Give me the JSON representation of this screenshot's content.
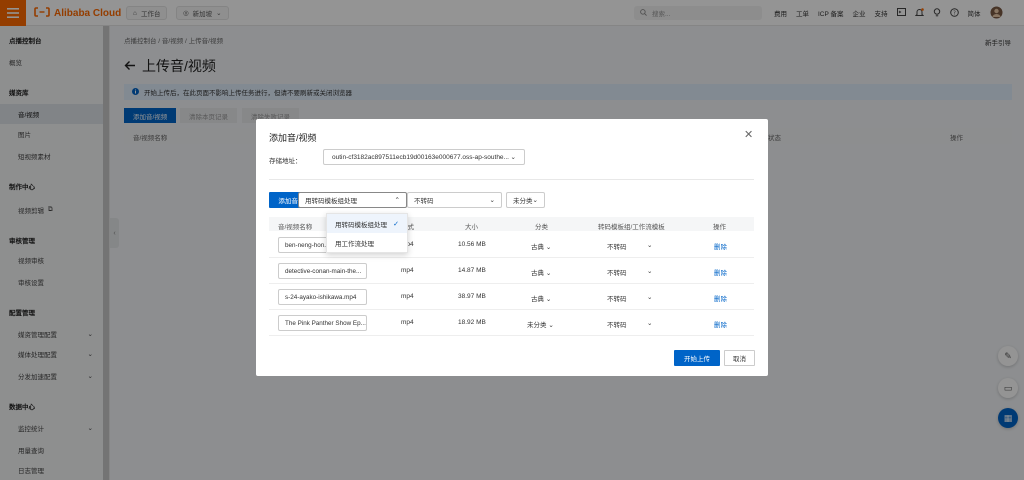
{
  "topbar": {
    "brand": "Alibaba Cloud",
    "workbench": "工作台",
    "region": "新加坡",
    "search_placeholder": "搜索...",
    "nav": [
      "费用",
      "工单",
      "ICP 备案",
      "企业",
      "支持"
    ],
    "lang": "简体",
    "accent": "#ff6a00"
  },
  "sidebar": {
    "title": "点播控制台",
    "items": [
      {
        "label": "概览",
        "type": "item"
      },
      {
        "label": "媒资库",
        "type": "section"
      },
      {
        "label": "音/视频",
        "type": "sub",
        "active": true
      },
      {
        "label": "图片",
        "type": "sub"
      },
      {
        "label": "短视频素材",
        "type": "sub"
      },
      {
        "label": "制作中心",
        "type": "section"
      },
      {
        "label": "视频剪辑",
        "type": "sub",
        "icon": "external-link-icon"
      },
      {
        "label": "审核管理",
        "type": "section"
      },
      {
        "label": "视频审核",
        "type": "sub"
      },
      {
        "label": "审核设置",
        "type": "sub"
      },
      {
        "label": "配置管理",
        "type": "section"
      },
      {
        "label": "媒资管理配置",
        "type": "sub",
        "chevron": true
      },
      {
        "label": "媒体处理配置",
        "type": "sub",
        "chevron": true
      },
      {
        "label": "分发加速配置",
        "type": "sub",
        "chevron": true
      },
      {
        "label": "数据中心",
        "type": "section"
      },
      {
        "label": "监控统计",
        "type": "sub",
        "chevron": true
      },
      {
        "label": "用量查询",
        "type": "sub"
      },
      {
        "label": "日志管理",
        "type": "sub"
      }
    ]
  },
  "main": {
    "breadcrumb": "点播控制台 / 音/视频 / 上传音/视频",
    "novice_guide": "新手引导",
    "title": "上传音/视频",
    "notice": "开始上传后，在此页面不影响上传任务进行，但请不要刷新或关闭浏览器",
    "tab_add": "添加音/视频",
    "tab2": "清除本页记录",
    "tab3": "清除失败记录",
    "table_head_name": "音/视频名称",
    "table_head_ops": "操作",
    "table_head_status": "状态"
  },
  "modal": {
    "title": "添加音/视频",
    "storage_label": "存储地址：",
    "storage_value": "outin-cf3182ac897511ecb19d00163e000677.oss-ap-southe...",
    "add_button": "添加音/视频",
    "process_select": "用转码模板组处理",
    "transcode_select": "不转码",
    "category_select": "未分类",
    "columns": [
      "音/视频名称",
      "格式",
      "大小",
      "分类",
      "转码模板组/工作流模板",
      "操作"
    ],
    "rows": [
      {
        "name": "ben-neng-hon...",
        "format": "mp4",
        "size": "10.56 MB",
        "category": "古典",
        "template": "不转码",
        "op": "删除"
      },
      {
        "name": "detective-conan-main-the...",
        "format": "mp4",
        "size": "14.87 MB",
        "category": "古典",
        "template": "不转码",
        "op": "删除"
      },
      {
        "name": "s-24-ayako-ishikawa.mp4",
        "format": "mp4",
        "size": "38.97 MB",
        "category": "古典",
        "template": "不转码",
        "op": "删除"
      },
      {
        "name": "The Pink Panther Show Ep...",
        "format": "mp4",
        "size": "18.92 MB",
        "category": "未分类",
        "template": "不转码",
        "op": "删除"
      }
    ],
    "start_button": "开始上传",
    "cancel_button": "取消",
    "primary_color": "#0064c8"
  },
  "dropdown": {
    "options": [
      {
        "label": "用转码模板组处理",
        "selected": true
      },
      {
        "label": "用工作流处理",
        "selected": false
      }
    ]
  }
}
